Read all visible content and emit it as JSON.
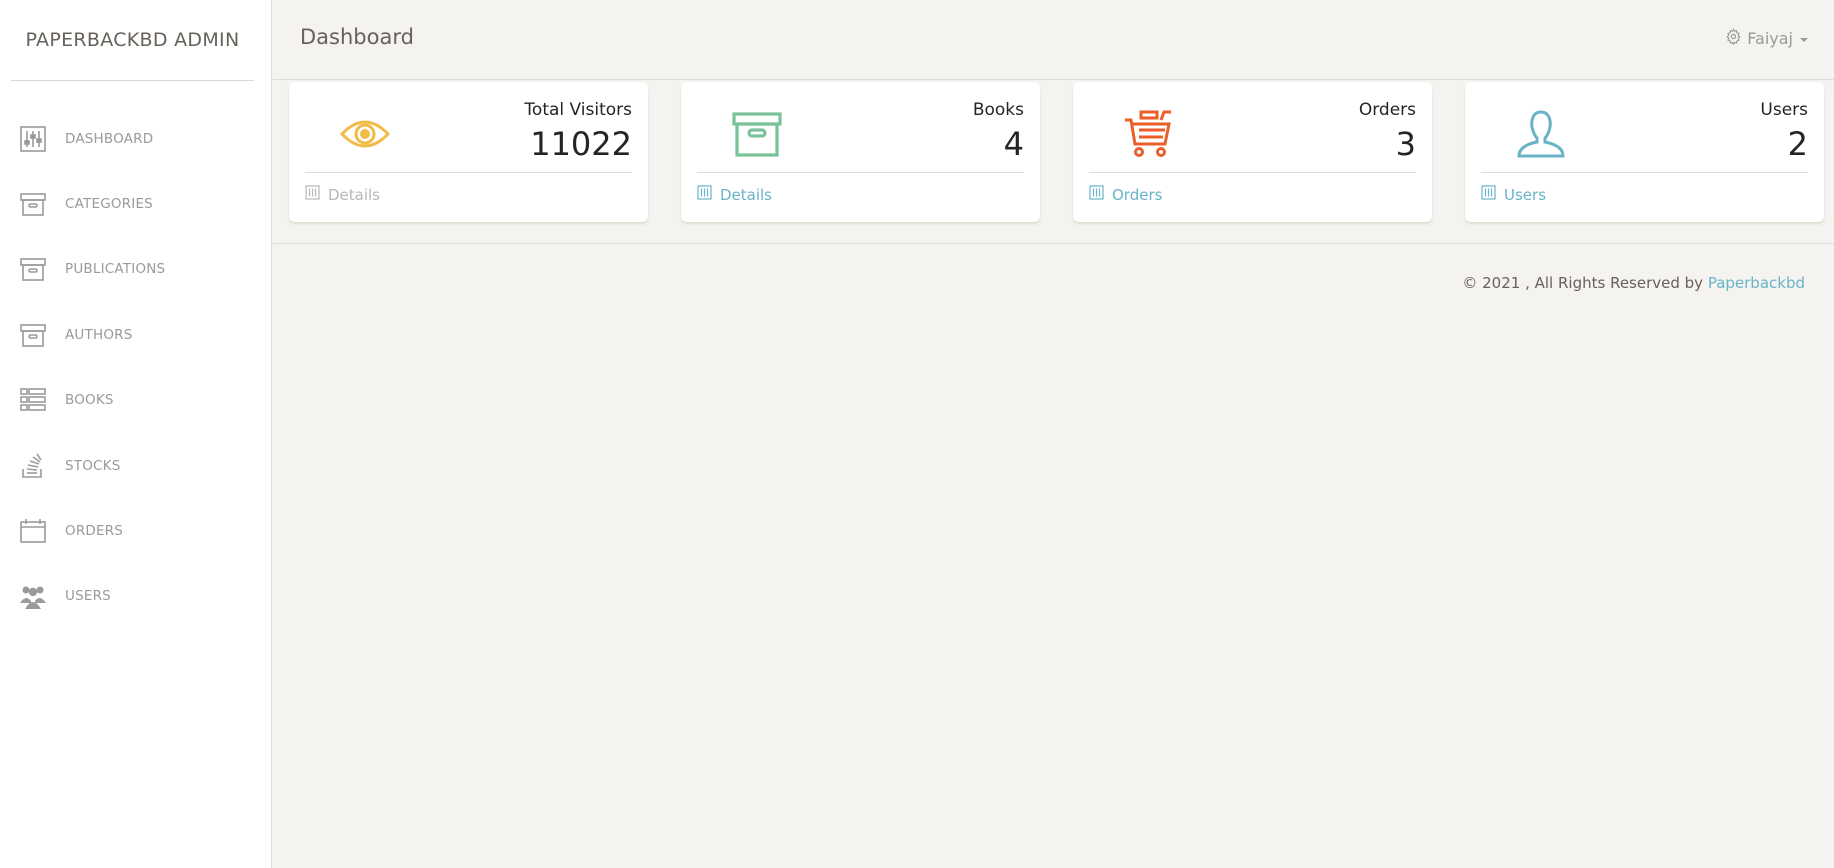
{
  "brand": "PAPERBACKBD ADMIN",
  "header": {
    "title": "Dashboard",
    "user": "Faiyaj"
  },
  "sidebar": {
    "items": [
      {
        "label": "DASHBOARD",
        "icon": "sliders-icon"
      },
      {
        "label": "CATEGORIES",
        "icon": "archive-icon"
      },
      {
        "label": "PUBLICATIONS",
        "icon": "archive-icon"
      },
      {
        "label": "AUTHORS",
        "icon": "archive-icon"
      },
      {
        "label": "BOOKS",
        "icon": "list-icon"
      },
      {
        "label": "STOCKS",
        "icon": "stack-icon"
      },
      {
        "label": "ORDERS",
        "icon": "calendar-icon"
      },
      {
        "label": "USERS",
        "icon": "users-icon"
      }
    ]
  },
  "stats": [
    {
      "title": "Total Visitors",
      "value": "11022",
      "link": "Details",
      "icon": "eye-icon",
      "color": "#f3bb45",
      "link_color": "#b7b7b7"
    },
    {
      "title": "Books",
      "value": "4",
      "link": "Details",
      "icon": "archive-icon",
      "color": "#7ac29a",
      "link_color": "#68b3c8"
    },
    {
      "title": "Orders",
      "value": "3",
      "link": "Orders",
      "icon": "cart-icon",
      "color": "#eb5e28",
      "link_color": "#68b3c8"
    },
    {
      "title": "Users",
      "value": "2",
      "link": "Users",
      "icon": "user-icon",
      "color": "#68b3c8",
      "link_color": "#68b3c8"
    }
  ],
  "footer": {
    "text": "© 2021 , All Rights Reserved by ",
    "link": "Paperbackbd"
  },
  "colors": {
    "sidebar_icon": "#9a9a9a",
    "link": "#68b3c8"
  }
}
